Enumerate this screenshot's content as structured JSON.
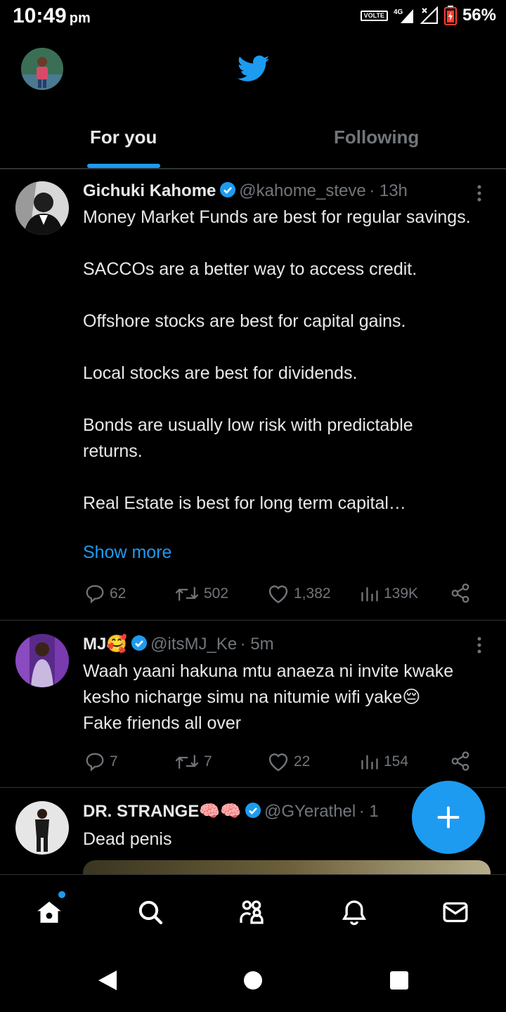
{
  "status_bar": {
    "time": "10:49",
    "ampm": "pm",
    "volte_label": "VOLTE",
    "network": "4G",
    "battery_percent": "56%"
  },
  "tabs": [
    {
      "label": "For you",
      "active": true
    },
    {
      "label": "Following",
      "active": false
    }
  ],
  "tweets": [
    {
      "name": "Gichuki Kahome",
      "verified": true,
      "handle": "@kahome_steve",
      "time": "· 13h",
      "text": "Money Market Funds are best for regular savings.\n\nSACCOs are a better way to access credit.\n\nOffshore stocks are best for capital gains.\n\nLocal stocks are best for dividends.\n\nBonds are usually low risk with predictable returns.\n\nReal Estate is best for long term capital…",
      "show_more": "Show more",
      "replies": "62",
      "retweets": "502",
      "likes": "1,382",
      "views": "139K"
    },
    {
      "name": "MJ🥰",
      "verified": true,
      "handle": "@itsMJ_Ke",
      "time": "· 5m",
      "text": "Waah yaani hakuna mtu anaeza ni invite kwake kesho nicharge simu na nitumie wifi yake😔\nFake friends all over",
      "replies": "7",
      "retweets": "7",
      "likes": "22",
      "views": "154"
    },
    {
      "name": "DR. STRANGE🧠🧠",
      "verified": true,
      "handle": "@GYerathel",
      "time": "· 1",
      "text": "Dead penis"
    }
  ],
  "colors": {
    "accent": "#1d9bf0",
    "background": "#000000",
    "secondary_text": "#71767b",
    "divider": "#2f3336"
  },
  "icons": {
    "logo": "twitter-bird-icon",
    "fab": "plus-icon",
    "nav": [
      "home-icon",
      "search-icon",
      "communities-icon",
      "notifications-icon",
      "messages-icon"
    ],
    "system_nav": [
      "back-icon",
      "home-circle-icon",
      "recents-icon"
    ]
  }
}
